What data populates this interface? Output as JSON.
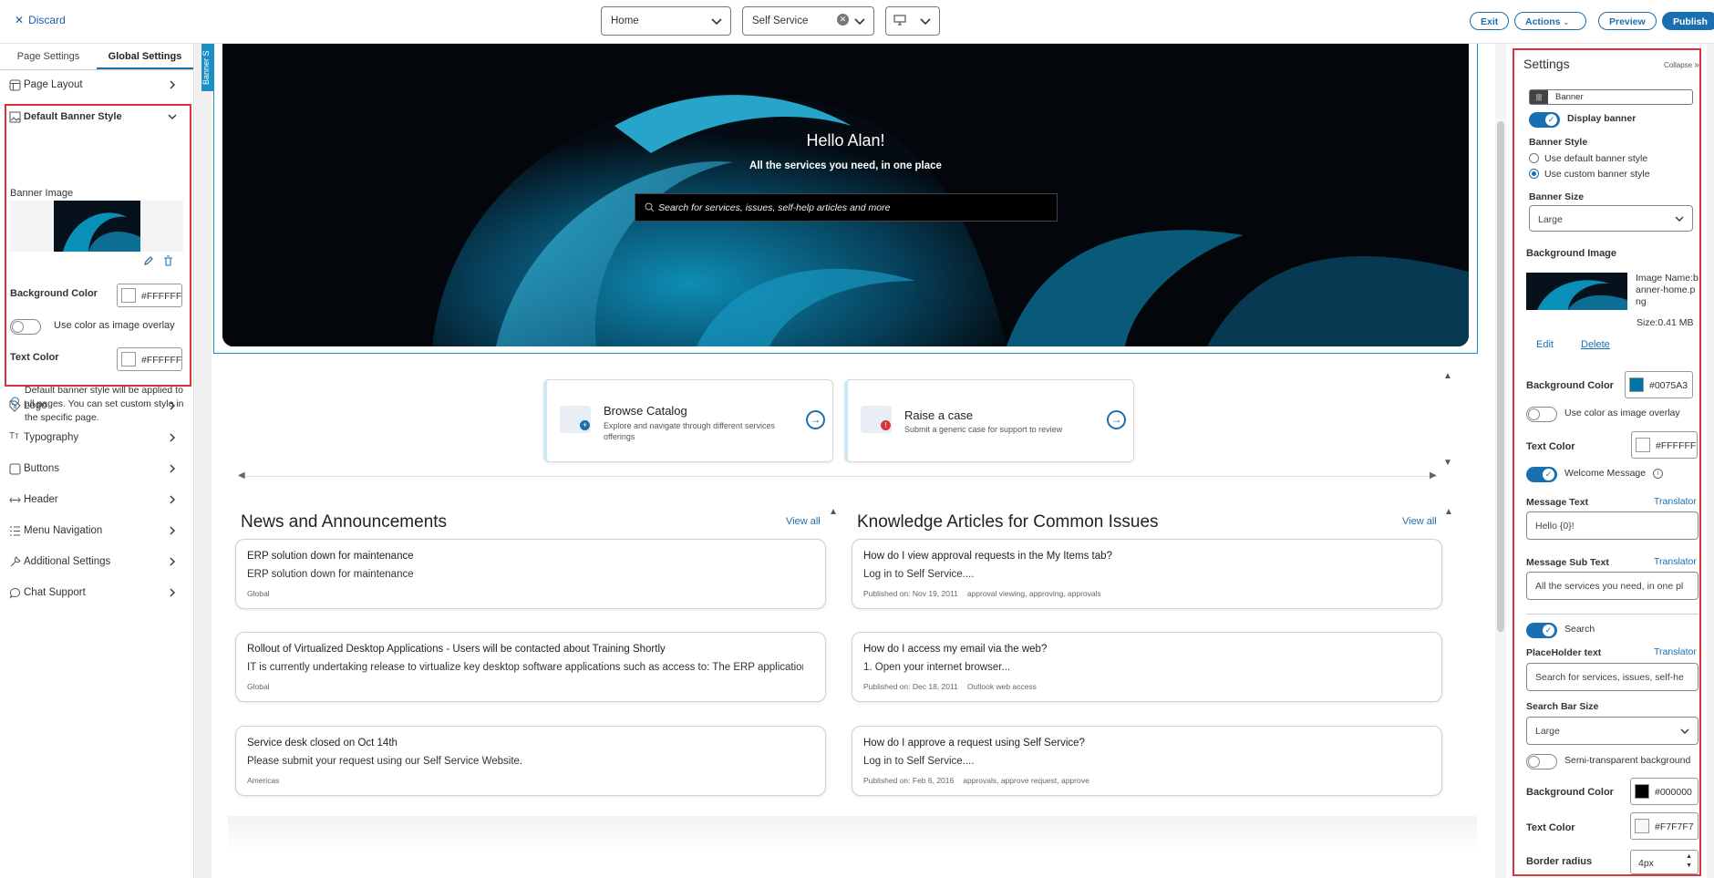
{
  "topbar": {
    "discard_label": "Discard",
    "page_select": "Home",
    "portal_select": "Self Service",
    "exit_label": "Exit",
    "actions_label": "Actions",
    "preview_label": "Preview",
    "publish_label": "Publish"
  },
  "left": {
    "tabs": [
      "Page Settings",
      "Global Settings"
    ],
    "page_layout": "Page Layout",
    "banner": {
      "title": "Default Banner Style",
      "image_label": "Banner Image",
      "bg_label": "Background Color",
      "bg_value": "#FFFFFF",
      "overlay_label": "Use color as image overlay",
      "text_label": "Text Color",
      "text_value": "#FFFFFF",
      "note": "Default banner style will be applied to all pages. You can set custom style in the specific page."
    },
    "items": [
      "Logo",
      "Typography",
      "Buttons",
      "Header",
      "Menu Navigation",
      "Additional Settings",
      "Chat Support"
    ]
  },
  "center": {
    "banner_tag": "Banner S",
    "hero": {
      "greeting": "Hello Alan!",
      "subtitle": "All the services you need, in one place",
      "search_placeholder": "Search for services, issues, self-help articles and more"
    },
    "cards": [
      {
        "title": "Browse Catalog",
        "desc": "Explore and navigate through different services offerings"
      },
      {
        "title": "Raise a case",
        "desc": "Submit a generic case for support to review"
      }
    ],
    "news": {
      "title": "News and Announcements",
      "view_all": "View all",
      "items": [
        {
          "title": "ERP solution down for maintenance",
          "body": "ERP solution down for maintenance",
          "meta": "Global"
        },
        {
          "title": "Rollout of Virtualized Desktop Applications - Users will be contacted about Training Shortly",
          "body": "IT is currently undertaking release to virtualize key desktop software applications such as access to: The ERP application...",
          "meta": "Global"
        },
        {
          "title": "Service desk closed on Oct 14th",
          "body": "Please submit your request using our Self Service Website.",
          "meta": "Americas"
        }
      ]
    },
    "kb": {
      "title": "Knowledge Articles for Common Issues",
      "view_all": "View all",
      "items": [
        {
          "title": "How do I view approval requests in the My Items tab?",
          "body": "Log in to Self Service....",
          "date": "Published on: Nov 19, 2011",
          "tags": "approval viewing, approving, approvals"
        },
        {
          "title": "How do I access my email via the web?",
          "body": "1. Open your internet browser...",
          "date": "Published on: Dec 18, 2011",
          "tags": "Outlook web access"
        },
        {
          "title": "How do I approve a request using Self Service?",
          "body": "Log in to Self Service....",
          "date": "Published on: Feb 6, 2016",
          "tags": "approvals, approve request, approve"
        }
      ]
    }
  },
  "right": {
    "title": "Settings",
    "collapse": "Collapse",
    "component": "Banner",
    "display_banner": "Display banner",
    "style_label": "Banner Style",
    "style_default": "Use default banner style",
    "style_custom": "Use custom banner style",
    "size_label": "Banner Size",
    "size_value": "Large",
    "bg_image_label": "Background Image",
    "image_name": "Image Name:banner-home.png",
    "image_size": "Size:0.41 MB",
    "edit": "Edit",
    "delete": "Delete",
    "bg_color_label": "Background Color",
    "bg_color_value": "#0075A3",
    "overlay_label": "Use color as image overlay",
    "text_color_label": "Text Color",
    "text_color_value": "#FFFFFF",
    "welcome_label": "Welcome Message",
    "msg_text_label": "Message Text",
    "translator": "Translator",
    "msg_text_value": "Hello {0}!",
    "msg_sub_label": "Message Sub Text",
    "msg_sub_value": "All the services you need, in one pl",
    "search_label": "Search",
    "placeholder_label": "PlaceHolder text",
    "placeholder_value": "Search for services, issues, self-he",
    "search_size_label": "Search Bar Size",
    "search_size_value": "Large",
    "semi_label": "Semi-transparent background",
    "search_bg_label": "Background Color",
    "search_bg_value": "#000000",
    "search_text_label": "Text Color",
    "search_text_value": "#F7F7F7",
    "radius_label": "Border radius",
    "radius_value": "4px"
  },
  "colors": {
    "accent": "#1a6fb0",
    "highlight": "#d9343a",
    "banner_bg": "#0075A3"
  }
}
